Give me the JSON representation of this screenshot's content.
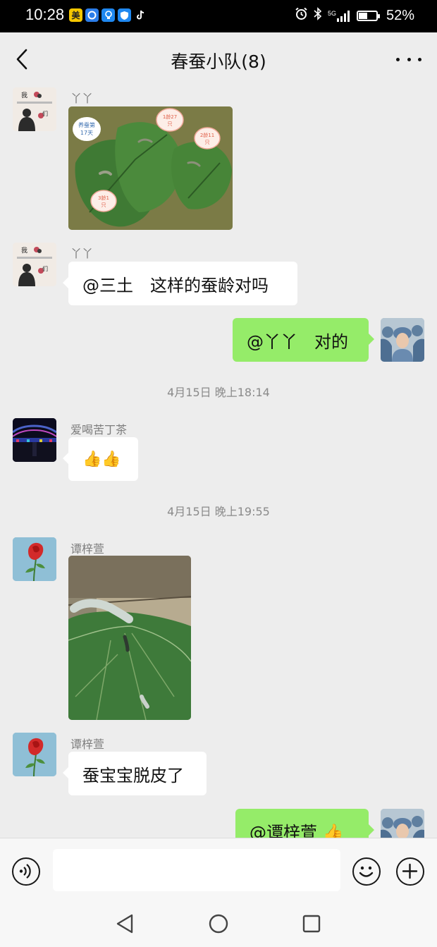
{
  "status_bar": {
    "time": "10:28",
    "app_icons": [
      "meituan-icon",
      "qq-browser-icon",
      "bulb-icon",
      "shield-app-icon",
      "tiktok-icon"
    ],
    "meituan_label": "美",
    "signal_label": "5G",
    "battery": "52%",
    "battery_level": 0.52
  },
  "header": {
    "title": "春蚕小队(8)"
  },
  "messages": [
    {
      "sender": "丫丫",
      "type": "image",
      "stickers": [
        "养蚕第17天",
        "1龄27只",
        "2龄11只",
        "3龄1只"
      ]
    },
    {
      "sender": "丫丫",
      "type": "text",
      "text": "@三土　这样的蚕龄对吗"
    },
    {
      "sender": "me",
      "type": "text",
      "text": "@丫丫　对的"
    },
    {
      "type": "time",
      "text": "4月15日 晚上18:14"
    },
    {
      "sender": "爱喝苦丁茶",
      "type": "emoji",
      "text": "👍👍"
    },
    {
      "type": "time",
      "text": "4月15日 晚上19:55"
    },
    {
      "sender": "谭梓萱",
      "type": "image"
    },
    {
      "sender": "谭梓萱",
      "type": "text",
      "text": "蚕宝宝脱皮了"
    },
    {
      "sender": "me",
      "type": "text",
      "text": "@谭梓萱 👍"
    }
  ],
  "sticker_texts": {
    "s1": "养蚕第",
    "s1b": "17天",
    "s2": "1龄27",
    "s2b": "只",
    "s3": "2龄11",
    "s3b": "只",
    "s4": "3龄1",
    "s4b": "只"
  },
  "input": {
    "value": "",
    "placeholder": ""
  },
  "colors": {
    "background": "#ededed",
    "self_bubble": "#95ec69",
    "other_bubble": "#ffffff"
  }
}
